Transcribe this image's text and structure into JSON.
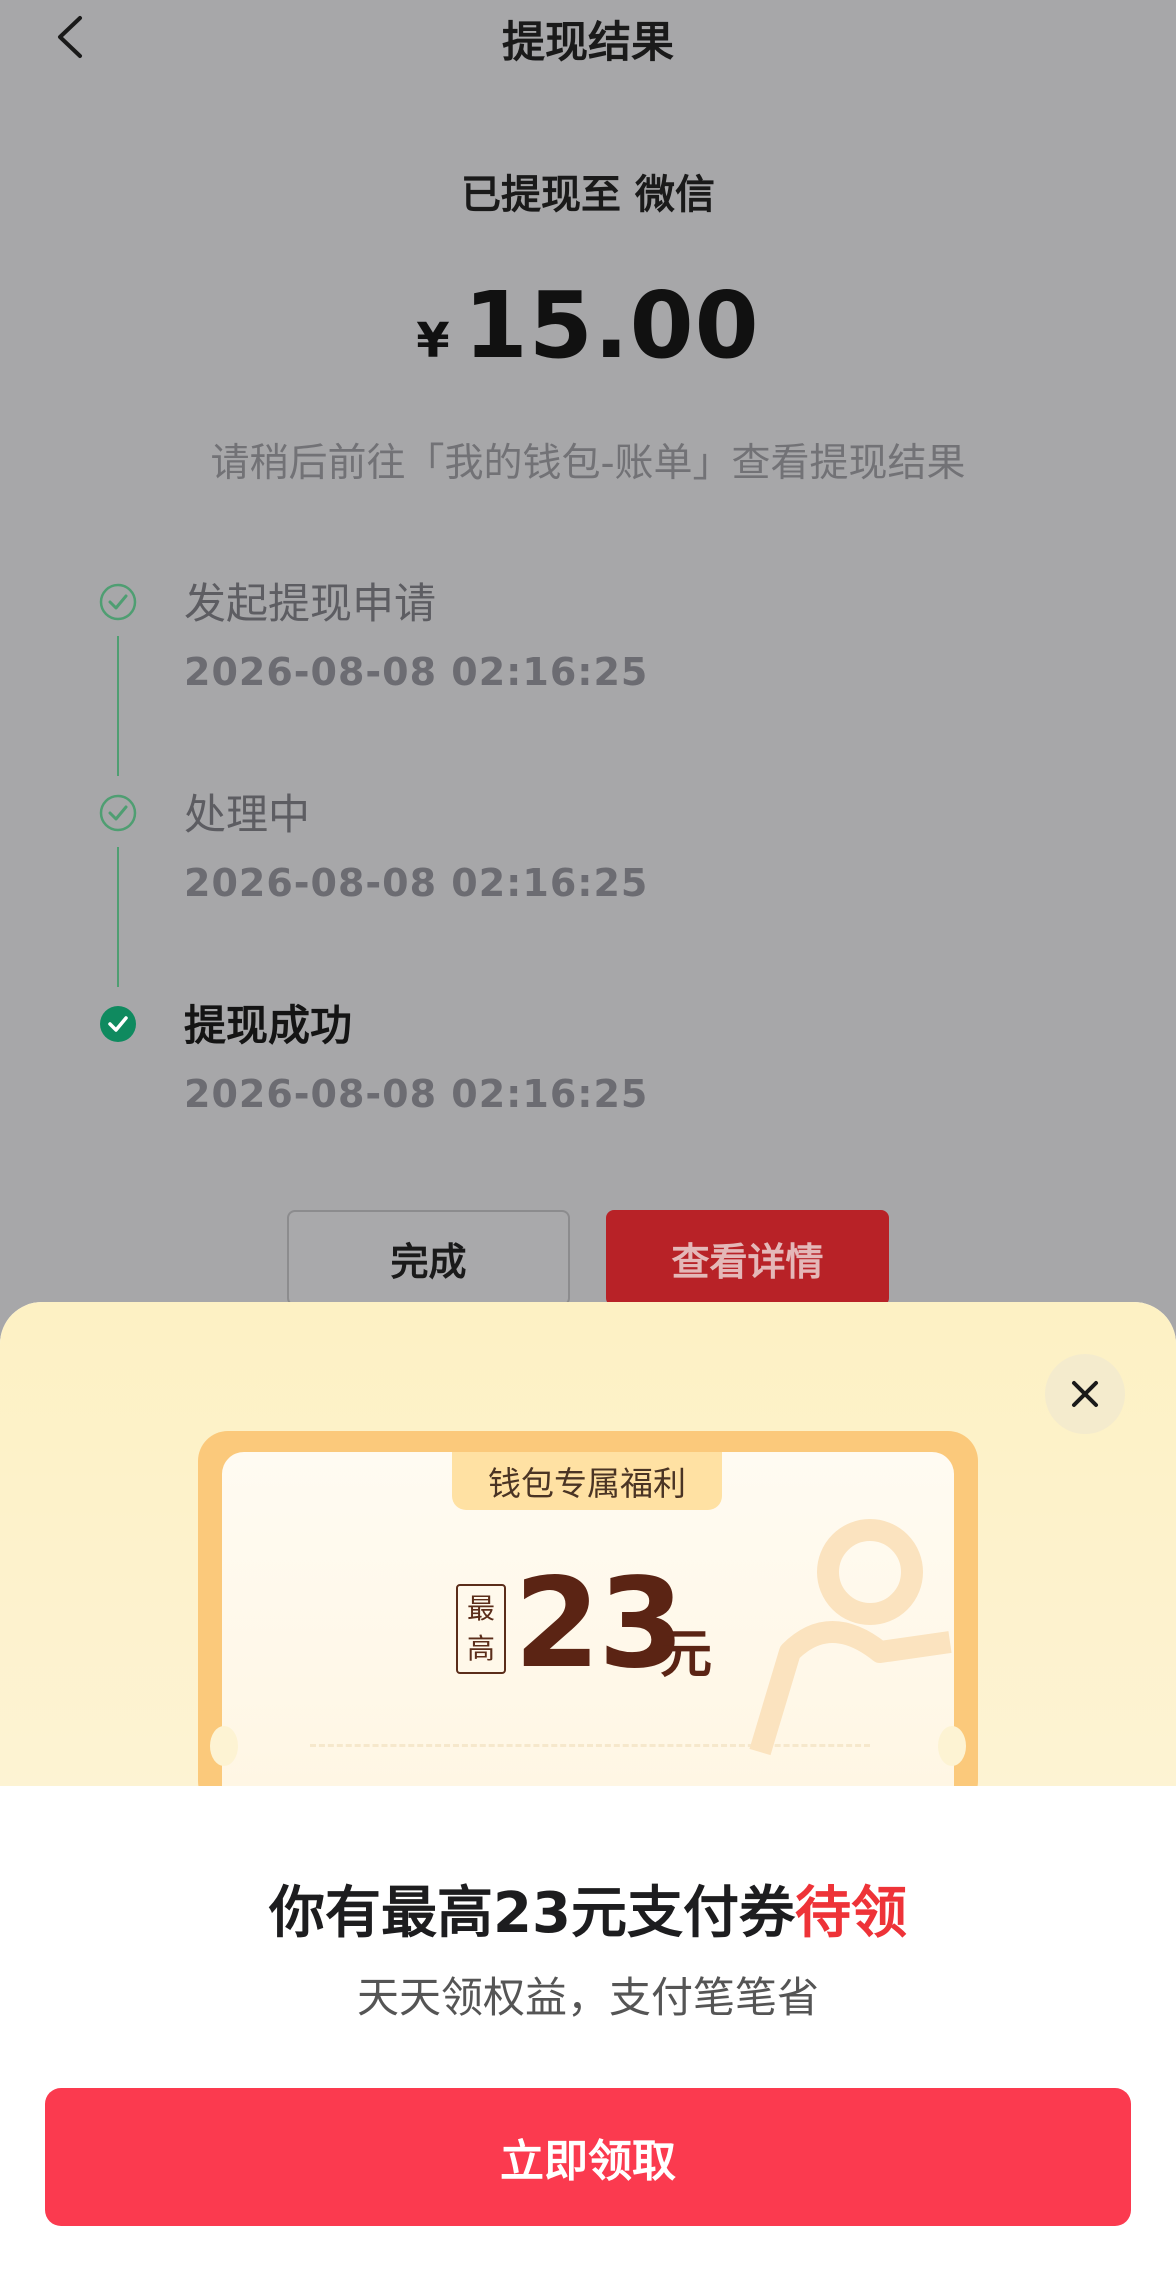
{
  "nav": {
    "title": "提现结果"
  },
  "result": {
    "destination": "已提现至 微信",
    "currency": "¥",
    "amount": "15.00",
    "hint": "请稍后前往「我的钱包-账单」查看提现结果"
  },
  "timeline": [
    {
      "title": "发起提现申请",
      "time": "2026-08-08 02:16:25",
      "status": "done"
    },
    {
      "title": "处理中",
      "time": "2026-08-08 02:16:25",
      "status": "done"
    },
    {
      "title": "提现成功",
      "time": "2026-08-08 02:16:25",
      "status": "current"
    }
  ],
  "actions": {
    "done_label": "完成",
    "detail_label": "查看详情"
  },
  "sheet": {
    "coupon_tag": "钱包专属福利",
    "max_label_top": "最",
    "max_label_bottom": "高",
    "coupon_value": "23",
    "coupon_unit": "元",
    "title_main": "你有最高23元支付券",
    "title_highlight": "待领",
    "subtitle": "天天领权益，支付笔笔省",
    "claim_label": "立即领取"
  },
  "colors": {
    "success_green": "#0f8a5f",
    "detail_red": "#b82227",
    "claim_red": "#fb3a4f",
    "highlight_red": "#ee3338",
    "coupon_orange": "#fbc97b"
  }
}
